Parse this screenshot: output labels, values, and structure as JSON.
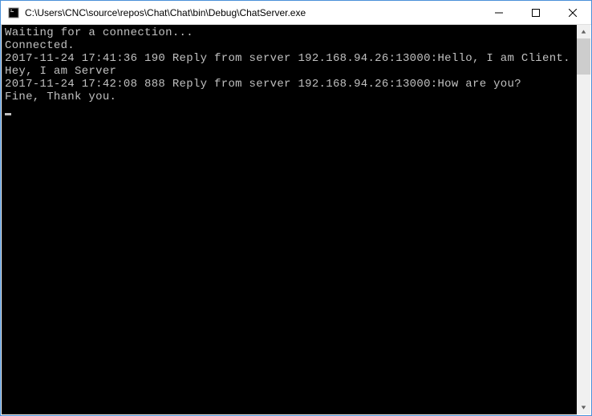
{
  "titlebar": {
    "title": "C:\\Users\\CNC\\source\\repos\\Chat\\Chat\\bin\\Debug\\ChatServer.exe"
  },
  "console": {
    "lines": [
      "Waiting for a connection...",
      "Connected.",
      "2017-11-24 17:41:36 190 Reply from server 192.168.94.26:13000:Hello, I am Client.",
      "Hey, I am Server",
      "2017-11-24 17:42:08 888 Reply from server 192.168.94.26:13000:How are you?",
      "Fine, Thank you."
    ]
  }
}
